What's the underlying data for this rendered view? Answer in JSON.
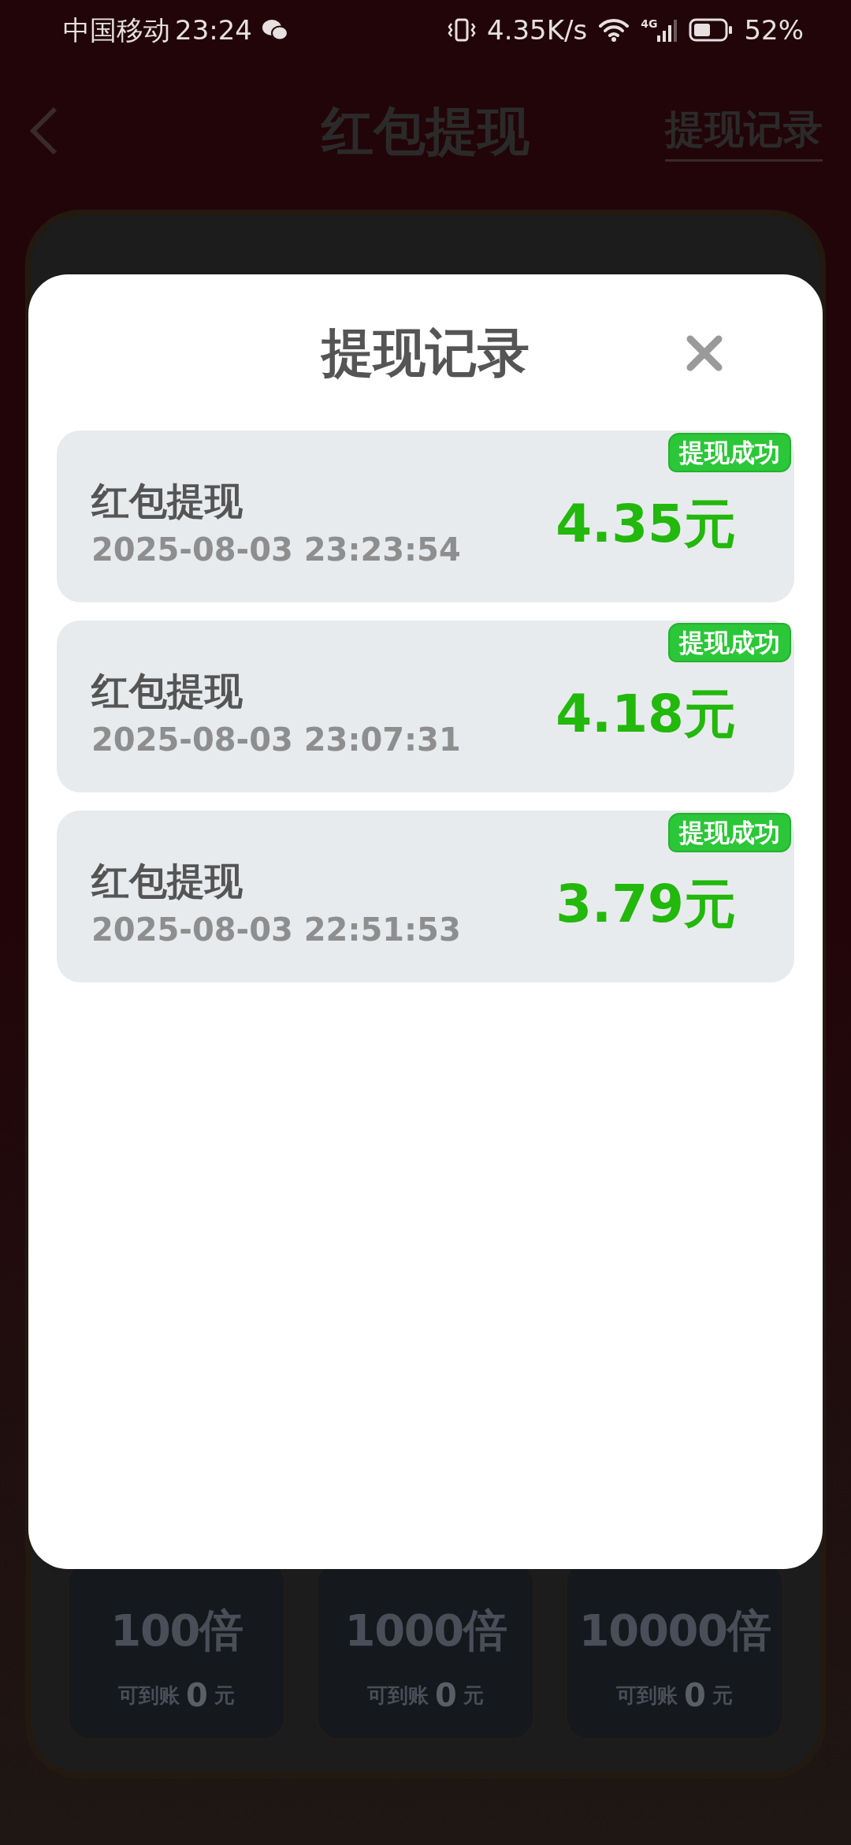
{
  "status_bar": {
    "carrier": "中国移动",
    "time": "23:24",
    "net_speed": "4.35K/s",
    "network": "4G",
    "battery": "52%"
  },
  "background_page": {
    "title": "红包提现",
    "header_link": "提现记录",
    "tiles": [
      {
        "multiple": "100倍",
        "caption": "可到账",
        "amount": "0",
        "unit": "元"
      },
      {
        "multiple": "1000倍",
        "caption": "可到账",
        "amount": "0",
        "unit": "元"
      },
      {
        "multiple": "10000倍",
        "caption": "可到账",
        "amount": "0",
        "unit": "元"
      }
    ]
  },
  "dialog": {
    "title": "提现记录",
    "records": [
      {
        "title": "红包提现",
        "time": "2025-08-03 23:23:54",
        "amount": "4.35元",
        "status": "提现成功"
      },
      {
        "title": "红包提现",
        "time": "2025-08-03 23:07:31",
        "amount": "4.18元",
        "status": "提现成功"
      },
      {
        "title": "红包提现",
        "time": "2025-08-03 22:51:53",
        "amount": "3.79元",
        "status": "提现成功"
      }
    ]
  }
}
